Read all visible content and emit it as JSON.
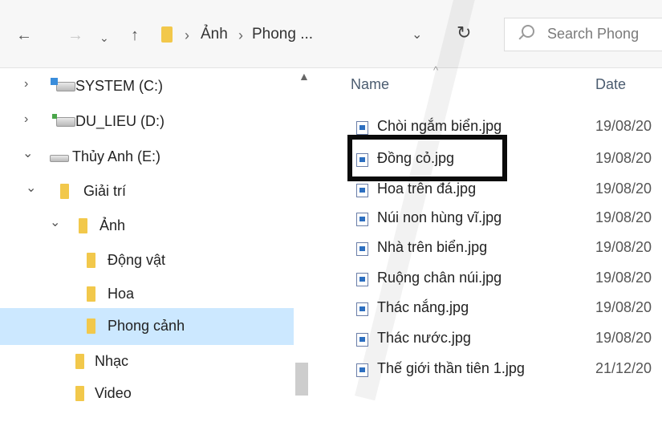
{
  "address_bar": {
    "back_icon": "arrow-left-icon",
    "forward_icon": "arrow-right-icon",
    "recent_icon": "chevron-down-icon",
    "up_icon": "arrow-up-icon",
    "path_separator_1": "›",
    "crumb_1": "Ảnh",
    "path_separator_2": "›",
    "crumb_2": "Phong ...",
    "dropdown_icon": "chevron-down-icon",
    "refresh_glyph": "↻",
    "search_placeholder": "Search Phong"
  },
  "nav_pane": {
    "items": [
      {
        "label": "SYSTEM (C:)",
        "chevron": "›"
      },
      {
        "label": "DU_LIEU (D:)",
        "chevron": "›"
      },
      {
        "label": "Thủy Anh (E:)",
        "chevron": "⌄"
      },
      {
        "label": "Giải trí",
        "chevron": "⌄"
      },
      {
        "label": "Ảnh",
        "chevron": "⌄"
      },
      {
        "label": "Động vật"
      },
      {
        "label": "Hoa"
      },
      {
        "label": "Phong cảnh",
        "selected": true
      },
      {
        "label": "Nhạc"
      },
      {
        "label": "Video"
      }
    ]
  },
  "content": {
    "columns": {
      "name": "Name",
      "date": "Date"
    },
    "files": [
      {
        "name": "Chòi ngắm biển.jpg",
        "date": "19/08/20"
      },
      {
        "name": "Đồng cỏ.jpg",
        "date": "19/08/20",
        "highlighted": true
      },
      {
        "name": "Hoa trên đá.jpg",
        "date": "19/08/20"
      },
      {
        "name": "Núi non hùng vĩ.jpg",
        "date": "19/08/20"
      },
      {
        "name": "Nhà trên biển.jpg",
        "date": "19/08/20"
      },
      {
        "name": "Ruộng chân núi.jpg",
        "date": "19/08/20"
      },
      {
        "name": "Thác nắng.jpg",
        "date": "19/08/20"
      },
      {
        "name": "Thác nước.jpg",
        "date": "19/08/20"
      },
      {
        "name": "Thế giới thần tiên 1.jpg",
        "date": "21/12/20"
      }
    ]
  },
  "colors": {
    "selection": "#cce8ff",
    "folder": "#f2c84b",
    "highlight_border": "#0b0b0b"
  }
}
